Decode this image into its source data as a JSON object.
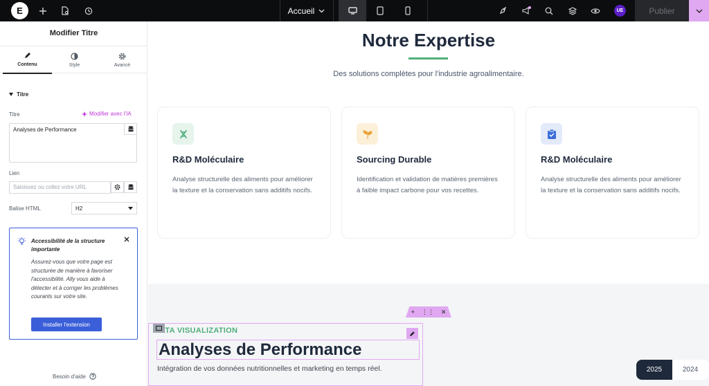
{
  "topbar": {
    "logo": "E",
    "page_name": "Accueil",
    "avatar": "UE",
    "publish_label": "Publier"
  },
  "sidebar": {
    "title": "Modifier Titre",
    "tabs": [
      {
        "label": "Contenu",
        "icon": "pencil-icon"
      },
      {
        "label": "Style",
        "icon": "half-circle-icon"
      },
      {
        "label": "Avancé",
        "icon": "gear-icon"
      }
    ],
    "section": "Titre",
    "title_label": "Titre",
    "ai_link": "Modifier avec l'IA",
    "title_value": "Analyses de Performance",
    "link_label": "Lien",
    "link_placeholder": "Saisissez ou collez votre URL",
    "html_tag_label": "Balise HTML",
    "html_tag_value": "H2",
    "notice": {
      "title": "Accessibilité de la structure importante",
      "body": "Assurez-vous que votre page est structurée de manière à favoriser l'accessibilité. Ally vous aide à détecter et à corriger les problèmes courants sur votre site.",
      "button": "Installer l'extension"
    },
    "help": "Besoin d'aide"
  },
  "canvas": {
    "heading": "Notre Expertise",
    "subheading": "Des solutions complètes pour l'industrie agroalimentaire.",
    "cards": [
      {
        "title": "R&D Moléculaire",
        "desc": "Analyse structurelle des aliments pour améliorer la texture et la conservation sans additifs nocifs.",
        "icon": "dna-icon",
        "icon_bg": "#e6f4ec",
        "icon_color": "#4fae7b"
      },
      {
        "title": "Sourcing Durable",
        "desc": "Identification et validation de matières premières à faible impact carbone pour vos recettes.",
        "icon": "sprout-icon",
        "icon_bg": "#fdf0d9",
        "icon_color": "#e8a33a"
      },
      {
        "title": "R&D Moléculaire",
        "desc": "Analyse structurelle des aliments pour améliorer la texture et la conservation sans additifs nocifs.",
        "icon": "clipboard-check-icon",
        "icon_bg": "#e3eafa",
        "icon_color": "#3b6fd9"
      }
    ],
    "dataviz": {
      "tag": "DATA VISUALIZATION",
      "tag_visible": "ATA VISUALIZATION",
      "title": "Analyses de Performance",
      "subtitle": "Intégration de vos données nutritionnelles et marketing en temps réel.",
      "years": [
        "2025",
        "2024"
      ],
      "active_year": "2025"
    }
  }
}
